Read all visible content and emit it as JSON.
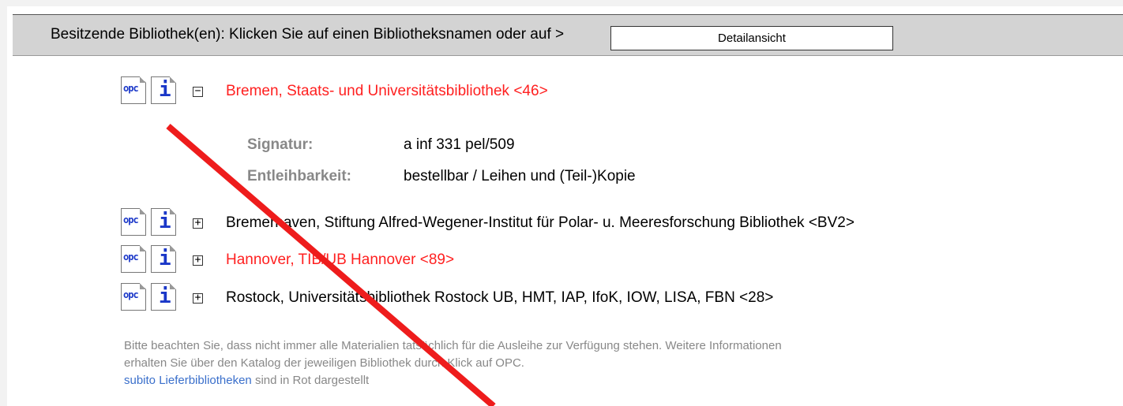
{
  "header": {
    "text": "Besitzende Bibliothek(en): Klicken Sie auf einen Bibliotheksnamen oder auf >",
    "detail_button_label": "Detailansicht"
  },
  "icons": {
    "opc_label": "opc",
    "info_label": "i"
  },
  "libraries": [
    {
      "name": "Bremen, Staats- und Universitätsbibliothek <46>",
      "color": "#ff2020",
      "expanded": true,
      "toggle": "−"
    },
    {
      "name": "Bremerhaven, Stiftung Alfred-Wegener-Institut für Polar- u. Meeresforschung Bibliothek <BV2>",
      "color": "#000000",
      "expanded": false,
      "toggle": "+"
    },
    {
      "name": "Hannover, TIB/UB Hannover <89>",
      "color": "#ff2020",
      "expanded": false,
      "toggle": "+"
    },
    {
      "name": "Rostock, Universitätsbibliothek Rostock UB, HMT, IAP, IfoK, IOW, LISA, FBN <28>",
      "color": "#000000",
      "expanded": false,
      "toggle": "+"
    }
  ],
  "details": {
    "signatur_label": "Signatur:",
    "signatur_value": "a inf 331 pel/509",
    "entleihbarkeit_label": "Entleihbarkeit:",
    "entleihbarkeit_value": "bestellbar / Leihen und (Teil-)Kopie"
  },
  "notice": {
    "line1": "Bitte beachten Sie, dass nicht immer alle Materialien tatsächlich für die Ausleihe zur Verfügung stehen. Weitere Informationen",
    "line2": "erhalten Sie über den Katalog der jeweiligen Bibliothek durch Klick auf OPC.",
    "link_text": "subito Lieferbibliotheken",
    "line3_rest": " sind in Rot dargestellt"
  },
  "colors": {
    "accent_red": "#ff2020",
    "link_blue": "#3a6fcb",
    "header_bg": "#d3d3d3",
    "icon_blue": "#1a37c8"
  }
}
